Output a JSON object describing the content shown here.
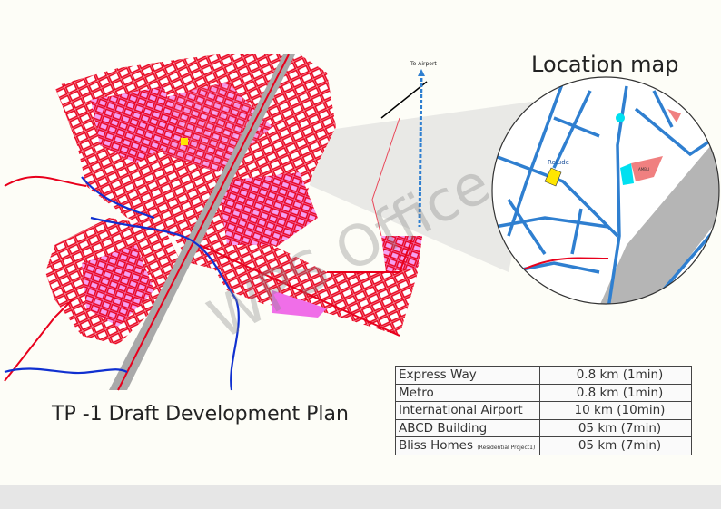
{
  "location_map": {
    "title": "Location map",
    "labels": {
      "site_logo": "Relude",
      "landmark": "AMBLI"
    }
  },
  "plan": {
    "title": "TP -1 Draft Development Plan",
    "to_airport_label": "To Airport"
  },
  "watermark": "WPS Office",
  "distances": [
    {
      "place": "Express Way",
      "note": "",
      "distance": "0.8 km (1min)"
    },
    {
      "place": "Metro",
      "note": "",
      "distance": "0.8 km (1min)"
    },
    {
      "place": "International Airport",
      "note": "",
      "distance": "10 km (10min)"
    },
    {
      "place": "ABCD Building",
      "note": "",
      "distance": "05 km (7min)"
    },
    {
      "place": "Bliss Homes",
      "note": "(Residential Project1)",
      "distance": "05 km (7min)"
    }
  ],
  "colors": {
    "zone_fill": "#f06ee8",
    "roads": "#e8001c",
    "river": "#1030d0",
    "highway": "#a9a9a9",
    "site": "#ffe600",
    "location_roads": "#2f7fd0"
  }
}
